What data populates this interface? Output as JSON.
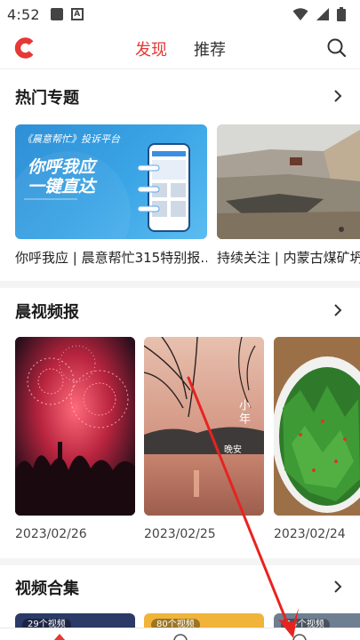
{
  "status_bar": {
    "time": "4:52",
    "notif_letter": "A"
  },
  "nav": {
    "tab_discover": "发现",
    "tab_recommend": "推荐"
  },
  "sections": {
    "hot_topics": {
      "title": "热门专题",
      "items": [
        {
          "caption": "你呼我应 | 晨意帮忙315特别报…",
          "banner_title": "《晨意帮忙》投诉平台",
          "banner_slogan_1": "你呼我应",
          "banner_slogan_2": "一键直达"
        },
        {
          "caption": "持续关注 | 内蒙古煤矿坍"
        }
      ]
    },
    "morning_video": {
      "title": "晨视频报",
      "items": [
        {
          "date": "2023/02/26"
        },
        {
          "date": "2023/02/25",
          "overlay_text_1": "小年",
          "overlay_text_2": "晚安"
        },
        {
          "date": "2023/02/24"
        }
      ]
    },
    "video_collections": {
      "title": "视频合集",
      "items": [
        {
          "badge": "29个视频"
        },
        {
          "badge": "80个视频"
        },
        {
          "badge": "14个视频"
        }
      ]
    }
  },
  "colors": {
    "accent": "#e53935",
    "divider": "#f4f4f4"
  }
}
